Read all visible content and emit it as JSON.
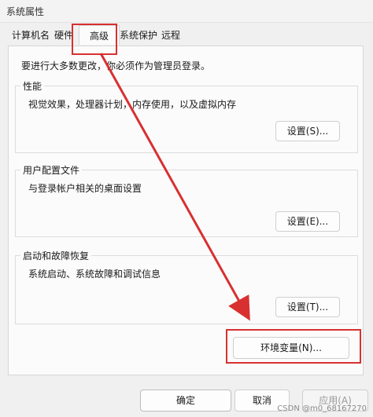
{
  "window": {
    "title": "系统属性"
  },
  "tabs": [
    {
      "label": "计算机名"
    },
    {
      "label": "硬件"
    },
    {
      "label": "高级"
    },
    {
      "label": "系统保护"
    },
    {
      "label": "远程"
    }
  ],
  "active_tab": "高级",
  "panel": {
    "intro": "要进行大多数更改，你必须作为管理员登录。",
    "groups": [
      {
        "title": "性能",
        "desc": "视觉效果，处理器计划，内存使用，以及虚拟内存",
        "button": "设置(S)..."
      },
      {
        "title": "用户配置文件",
        "desc": "与登录帐户相关的桌面设置",
        "button": "设置(E)..."
      },
      {
        "title": "启动和故障恢复",
        "desc": "系统启动、系统故障和调试信息",
        "button": "设置(T)..."
      }
    ],
    "env_button": "环境变量(N)..."
  },
  "footer": {
    "ok": "确定",
    "cancel": "取消",
    "apply": "应用(A)"
  },
  "watermark": "CSDN @m0_68167270",
  "colors": {
    "highlight": "#d83030",
    "background": "#f0f0f0",
    "panel": "#fbfbfb"
  }
}
